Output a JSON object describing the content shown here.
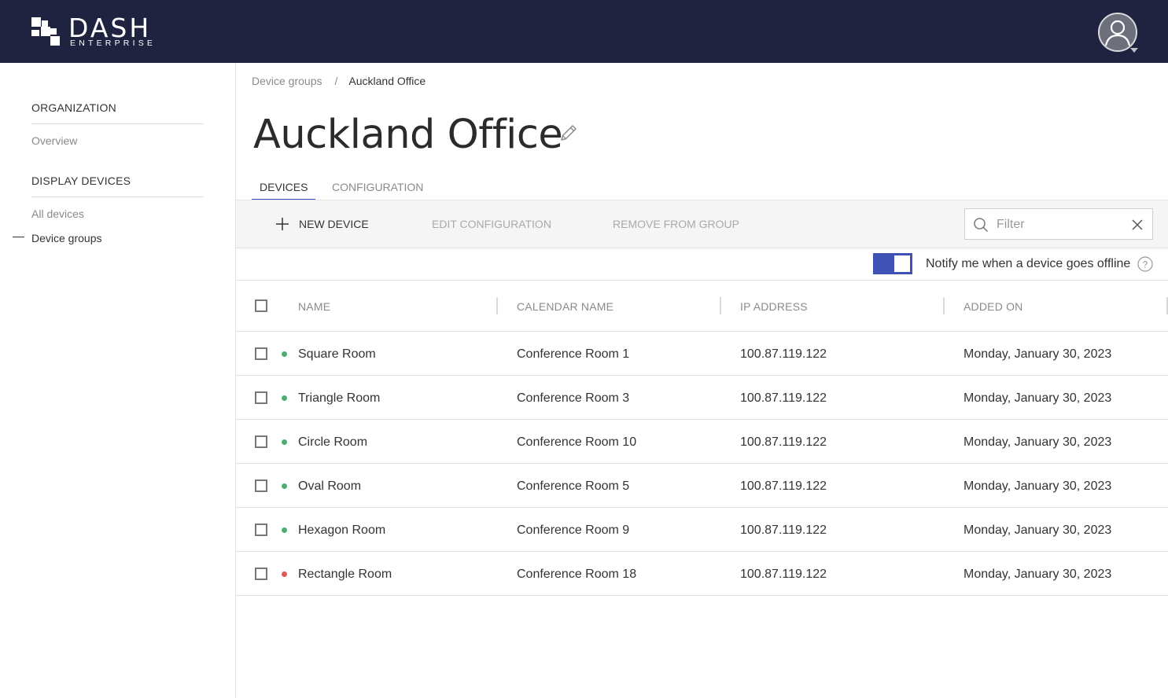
{
  "brand": {
    "name": "DASH",
    "subtitle": "ENTERPRISE"
  },
  "header": {
    "avatar_icon": "user-avatar-icon"
  },
  "sidebar": {
    "sections": [
      {
        "heading": "ORGANIZATION",
        "items": [
          {
            "label": "Overview",
            "active": false
          }
        ]
      },
      {
        "heading": "DISPLAY DEVICES",
        "items": [
          {
            "label": "All devices",
            "active": false
          },
          {
            "label": "Device groups",
            "active": true
          }
        ]
      }
    ]
  },
  "breadcrumb": {
    "parent": "Device groups",
    "separator": "/",
    "current": "Auckland Office"
  },
  "page": {
    "title": "Auckland Office"
  },
  "tabs": [
    {
      "label": "DEVICES",
      "active": true
    },
    {
      "label": "CONFIGURATION",
      "active": false
    }
  ],
  "toolbar": {
    "new_device": "NEW DEVICE",
    "edit_configuration": "EDIT CONFIGURATION",
    "remove_from_group": "REMOVE FROM GROUP",
    "filter_placeholder": "Filter"
  },
  "notify": {
    "label": "Notify me when a device goes offline",
    "enabled": true
  },
  "table": {
    "columns": [
      "NAME",
      "CALENDAR NAME",
      "IP ADDRESS",
      "ADDED ON"
    ],
    "rows": [
      {
        "name": "Square Room",
        "calendar": "Conference Room 1",
        "ip": "100.87.119.122",
        "added": "Monday, January 30, 2023",
        "status": "online"
      },
      {
        "name": "Triangle Room",
        "calendar": "Conference Room 3",
        "ip": "100.87.119.122",
        "added": "Monday, January 30, 2023",
        "status": "online"
      },
      {
        "name": "Circle Room",
        "calendar": "Conference Room 10",
        "ip": "100.87.119.122",
        "added": "Monday, January 30, 2023",
        "status": "online"
      },
      {
        "name": "Oval Room",
        "calendar": "Conference Room 5",
        "ip": "100.87.119.122",
        "added": "Monday, January 30, 2023",
        "status": "online"
      },
      {
        "name": "Hexagon Room",
        "calendar": "Conference Room 9",
        "ip": "100.87.119.122",
        "added": "Monday, January 30, 2023",
        "status": "online"
      },
      {
        "name": "Rectangle Room",
        "calendar": "Conference Room 18",
        "ip": "100.87.119.122",
        "added": "Monday, January 30, 2023",
        "status": "offline"
      }
    ]
  },
  "colors": {
    "header_bg": "#1f2340",
    "accent": "#3f51b5",
    "status_online": "#4caf6f",
    "status_offline": "#e05757"
  }
}
